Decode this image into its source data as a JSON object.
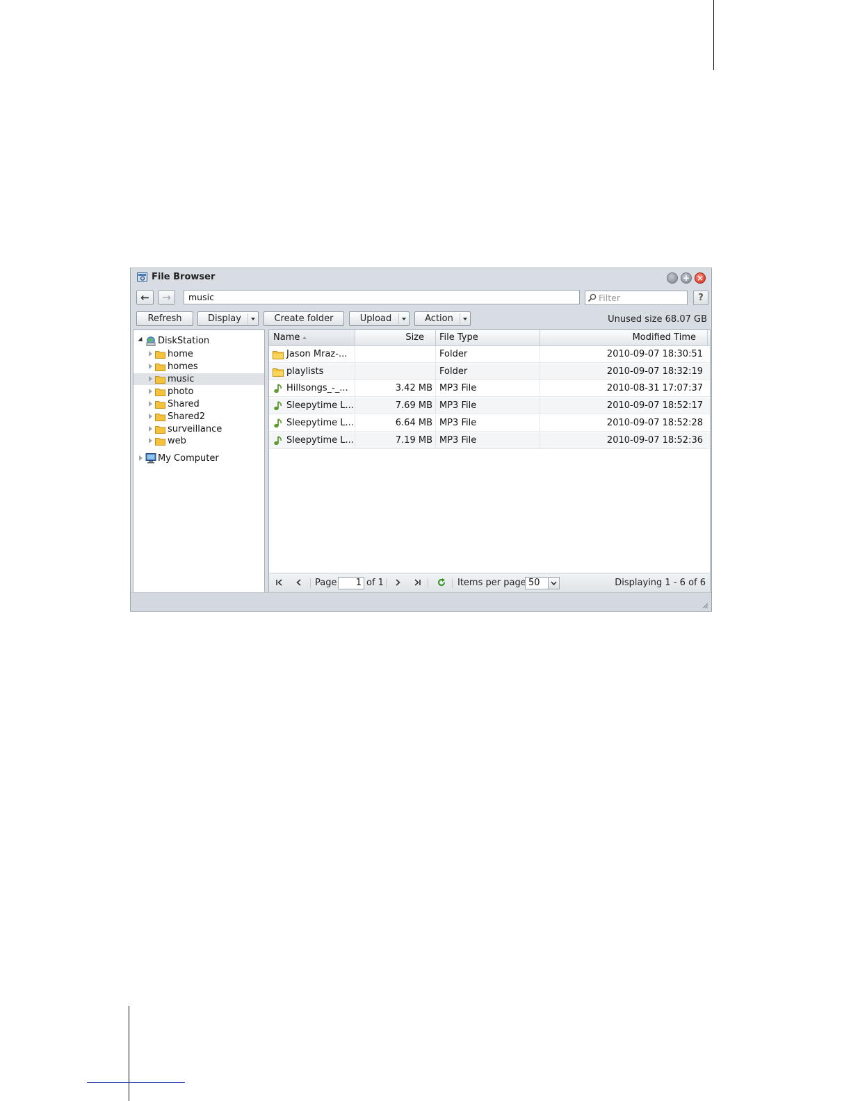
{
  "window": {
    "title": "File Browser"
  },
  "toolbar": {
    "path_value": "music",
    "filter_placeholder": "Filter",
    "help_label": "?",
    "refresh_label": "Refresh",
    "display_label": "Display",
    "create_folder_label": "Create folder",
    "upload_label": "Upload",
    "action_label": "Action",
    "unused_size": "Unused size 68.07 GB"
  },
  "tree": {
    "root": "DiskStation",
    "children": [
      "home",
      "homes",
      "music",
      "photo",
      "Shared",
      "Shared2",
      "surveillance",
      "web"
    ],
    "selected": "music",
    "my_computer": "My Computer"
  },
  "grid": {
    "columns": {
      "name": "Name",
      "size": "Size",
      "type": "File Type",
      "modified": "Modified Time"
    },
    "rows": [
      {
        "icon": "folder-icon",
        "name": "Jason Mraz-...",
        "size": "",
        "type": "Folder",
        "modified": "2010-09-07 18:30:51"
      },
      {
        "icon": "folder-icon",
        "name": "playlists",
        "size": "",
        "type": "Folder",
        "modified": "2010-09-07 18:32:19"
      },
      {
        "icon": "music-note-icon",
        "name": "Hillsongs_-_...",
        "size": "3.42 MB",
        "type": "MP3 File",
        "modified": "2010-08-31 17:07:37"
      },
      {
        "icon": "music-note-icon",
        "name": "Sleepytime L...",
        "size": "7.69 MB",
        "type": "MP3 File",
        "modified": "2010-09-07 18:52:17"
      },
      {
        "icon": "music-note-icon",
        "name": "Sleepytime L...",
        "size": "6.64 MB",
        "type": "MP3 File",
        "modified": "2010-09-07 18:52:28"
      },
      {
        "icon": "music-note-icon",
        "name": "Sleepytime L...",
        "size": "7.19 MB",
        "type": "MP3 File",
        "modified": "2010-09-07 18:52:36"
      }
    ]
  },
  "pager": {
    "page_label": "Page",
    "page_value": "1",
    "of_label": "of 1",
    "items_label": "Items per page",
    "items_value": "50",
    "displaying": "Displaying 1 - 6 of 6"
  },
  "colors": {
    "folder": "#f5c33b",
    "music": "#5d9a2e",
    "close": "#d42a16"
  }
}
